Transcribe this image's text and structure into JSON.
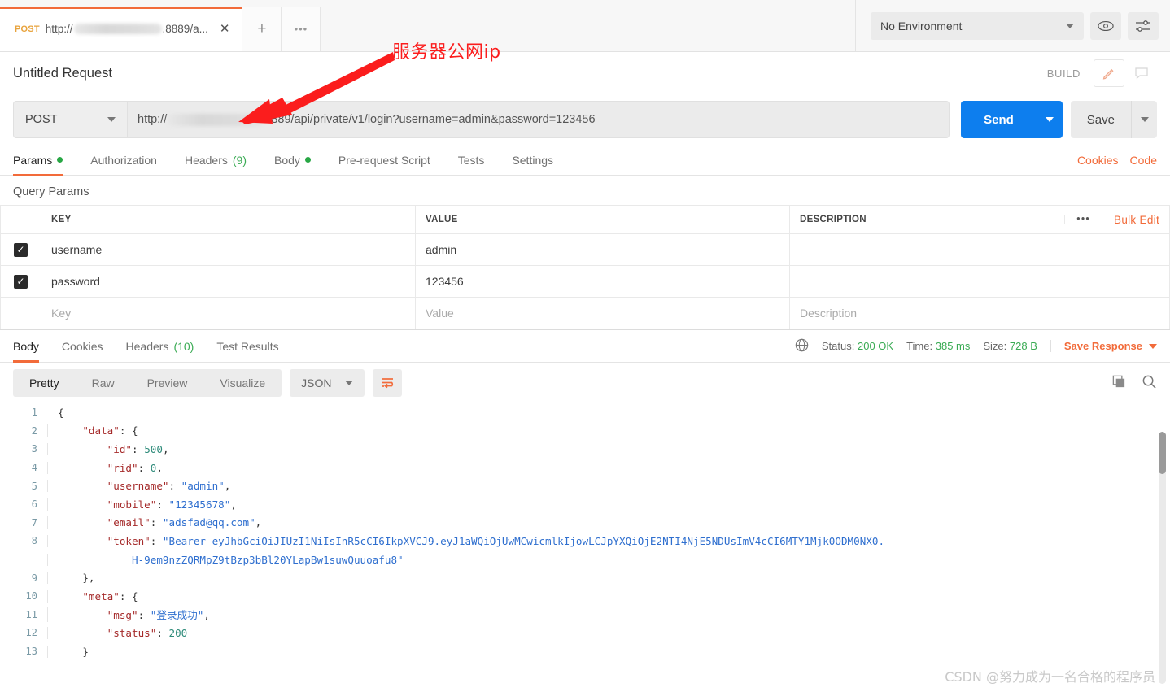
{
  "tabbar": {
    "request_tab": {
      "method": "POST",
      "url_prefix": "http://",
      "url_suffix": ".8889/a...",
      "close_icon": "close-icon"
    },
    "new_tab_label": "+",
    "more_tabs_label": "•••",
    "environment": {
      "selected": "No Environment"
    },
    "eye_icon": "eye-icon",
    "settings_icon": "sliders-icon"
  },
  "request": {
    "name": "Untitled Request",
    "build_label": "BUILD",
    "edit_icon": "pencil-icon",
    "comment_icon": "comment-icon",
    "method": "POST",
    "url_prefix": "http://",
    "url_suffix": "8889/api/private/v1/login?username=admin&password=123456",
    "send_label": "Send",
    "save_label": "Save",
    "tabs": [
      {
        "label": "Params",
        "dot": true,
        "active": true
      },
      {
        "label": "Authorization",
        "dot": false,
        "active": false
      },
      {
        "label": "Headers",
        "count": "(9)",
        "dot": false,
        "active": false
      },
      {
        "label": "Body",
        "dot": true,
        "active": false
      },
      {
        "label": "Pre-request Script",
        "dot": false,
        "active": false
      },
      {
        "label": "Tests",
        "dot": false,
        "active": false
      },
      {
        "label": "Settings",
        "dot": false,
        "active": false
      }
    ],
    "links": {
      "cookies": "Cookies",
      "code": "Code"
    }
  },
  "params": {
    "section_title": "Query Params",
    "headers": {
      "key": "KEY",
      "value": "VALUE",
      "description": "DESCRIPTION"
    },
    "dots_label": "•••",
    "bulk_edit": "Bulk Edit",
    "rows": [
      {
        "checked": true,
        "key": "username",
        "value": "admin",
        "description": ""
      },
      {
        "checked": true,
        "key": "password",
        "value": "123456",
        "description": ""
      }
    ],
    "placeholders": {
      "key": "Key",
      "value": "Value",
      "description": "Description"
    }
  },
  "response": {
    "tabs": [
      {
        "label": "Body",
        "active": true
      },
      {
        "label": "Cookies",
        "active": false
      },
      {
        "label": "Headers",
        "count": "(10)",
        "active": false
      },
      {
        "label": "Test Results",
        "active": false
      }
    ],
    "globe_icon": "globe-icon",
    "status_label": "Status:",
    "status_value": "200 OK",
    "time_label": "Time:",
    "time_value": "385 ms",
    "size_label": "Size:",
    "size_value": "728 B",
    "save_response": "Save Response",
    "format_tabs": [
      {
        "label": "Pretty",
        "active": true
      },
      {
        "label": "Raw",
        "active": false
      },
      {
        "label": "Preview",
        "active": false
      },
      {
        "label": "Visualize",
        "active": false
      }
    ],
    "language": "JSON",
    "wrap_icon": "word-wrap-icon",
    "copy_icon": "copy-icon",
    "search_icon": "search-icon",
    "body_lines": [
      {
        "n": "1",
        "tokens": [
          {
            "t": "p",
            "v": "{"
          }
        ]
      },
      {
        "n": "2",
        "tokens": [
          {
            "t": "p",
            "v": "    "
          },
          {
            "t": "k",
            "v": "\"data\""
          },
          {
            "t": "p",
            "v": ": {"
          }
        ]
      },
      {
        "n": "3",
        "tokens": [
          {
            "t": "p",
            "v": "        "
          },
          {
            "t": "k",
            "v": "\"id\""
          },
          {
            "t": "p",
            "v": ": "
          },
          {
            "t": "n",
            "v": "500"
          },
          {
            "t": "p",
            "v": ","
          }
        ]
      },
      {
        "n": "4",
        "tokens": [
          {
            "t": "p",
            "v": "        "
          },
          {
            "t": "k",
            "v": "\"rid\""
          },
          {
            "t": "p",
            "v": ": "
          },
          {
            "t": "n",
            "v": "0"
          },
          {
            "t": "p",
            "v": ","
          }
        ]
      },
      {
        "n": "5",
        "tokens": [
          {
            "t": "p",
            "v": "        "
          },
          {
            "t": "k",
            "v": "\"username\""
          },
          {
            "t": "p",
            "v": ": "
          },
          {
            "t": "s",
            "v": "\"admin\""
          },
          {
            "t": "p",
            "v": ","
          }
        ]
      },
      {
        "n": "6",
        "tokens": [
          {
            "t": "p",
            "v": "        "
          },
          {
            "t": "k",
            "v": "\"mobile\""
          },
          {
            "t": "p",
            "v": ": "
          },
          {
            "t": "s",
            "v": "\"12345678\""
          },
          {
            "t": "p",
            "v": ","
          }
        ]
      },
      {
        "n": "7",
        "tokens": [
          {
            "t": "p",
            "v": "        "
          },
          {
            "t": "k",
            "v": "\"email\""
          },
          {
            "t": "p",
            "v": ": "
          },
          {
            "t": "s",
            "v": "\"adsfad@qq.com\""
          },
          {
            "t": "p",
            "v": ","
          }
        ]
      },
      {
        "n": "8",
        "tokens": [
          {
            "t": "p",
            "v": "        "
          },
          {
            "t": "k",
            "v": "\"token\""
          },
          {
            "t": "p",
            "v": ": "
          },
          {
            "t": "s",
            "v": "\"Bearer eyJhbGciOiJIUzI1NiIsInR5cCI6IkpXVCJ9.eyJ1aWQiOjUwMCwicmlkIjowLCJpYXQiOjE2NTI4NjE5NDUsImV4cCI6MTY1Mjk0ODM0NX0."
          }
        ]
      },
      {
        "n": "",
        "tokens": [
          {
            "t": "p",
            "v": "            "
          },
          {
            "t": "s",
            "v": "H-9em9nzZQRMpZ9tBzp3bBl20YLapBw1suwQuuoafu8\""
          }
        ]
      },
      {
        "n": "9",
        "tokens": [
          {
            "t": "p",
            "v": "    },"
          }
        ]
      },
      {
        "n": "10",
        "tokens": [
          {
            "t": "p",
            "v": "    "
          },
          {
            "t": "k",
            "v": "\"meta\""
          },
          {
            "t": "p",
            "v": ": {"
          }
        ]
      },
      {
        "n": "11",
        "tokens": [
          {
            "t": "p",
            "v": "        "
          },
          {
            "t": "k",
            "v": "\"msg\""
          },
          {
            "t": "p",
            "v": ": "
          },
          {
            "t": "s",
            "v": "\"登录成功\""
          },
          {
            "t": "p",
            "v": ","
          }
        ]
      },
      {
        "n": "12",
        "tokens": [
          {
            "t": "p",
            "v": "        "
          },
          {
            "t": "k",
            "v": "\"status\""
          },
          {
            "t": "p",
            "v": ": "
          },
          {
            "t": "n",
            "v": "200"
          }
        ]
      },
      {
        "n": "13",
        "tokens": [
          {
            "t": "p",
            "v": "    }"
          }
        ]
      }
    ]
  },
  "annotation": {
    "text": "服务器公网ip",
    "color": "#fb1d1d"
  },
  "watermark": "CSDN @努力成为一名合格的程序员",
  "colors": {
    "accent_orange": "#f26b3a",
    "send_blue": "#0d7eee",
    "green": "#3aab54"
  }
}
